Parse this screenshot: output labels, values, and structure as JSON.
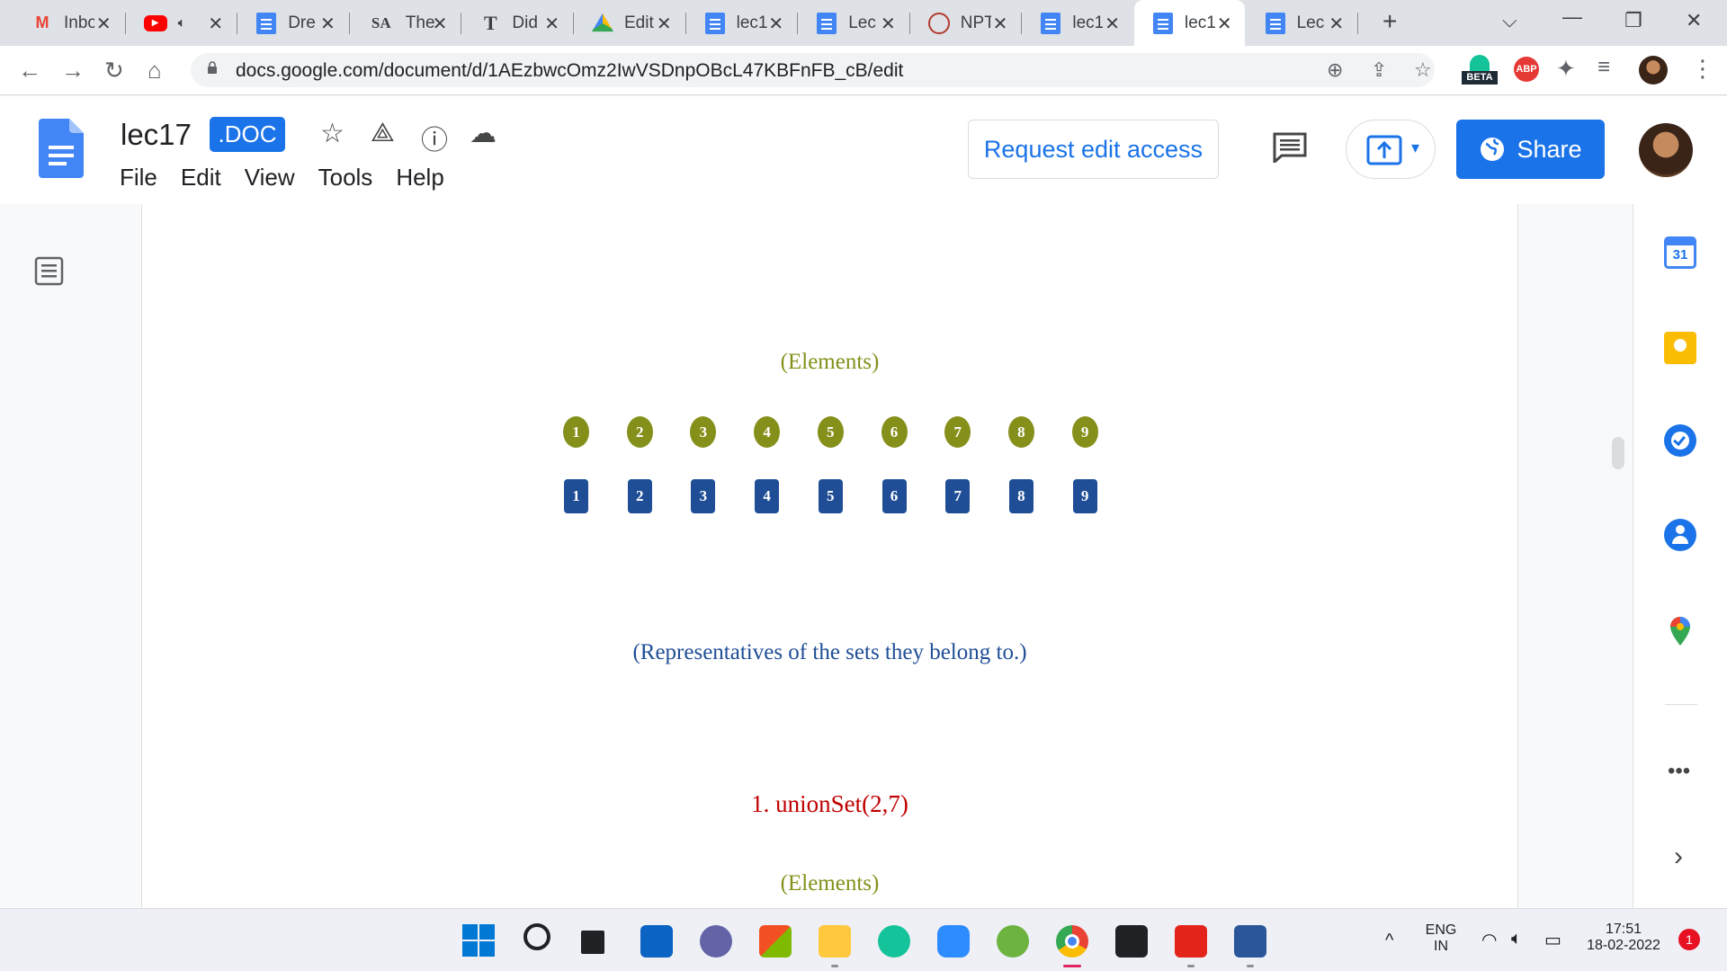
{
  "tabs": [
    {
      "title": "Inbox",
      "icon": "gmail-icon",
      "color": "#ea4335"
    },
    {
      "title": "",
      "icon": "youtube-icon",
      "color": "#ff0000",
      "muted": true
    },
    {
      "title": "Dre",
      "icon": "docs-icon",
      "color": "#4285f4"
    },
    {
      "title": "The",
      "icon": "sa-icon",
      "color": "#000000"
    },
    {
      "title": "Did",
      "icon": "nyt-icon",
      "color": "#000000"
    },
    {
      "title": "Edit",
      "icon": "drive-icon",
      "color": "#34a853"
    },
    {
      "title": "lec1",
      "icon": "docs-icon",
      "color": "#4285f4"
    },
    {
      "title": "Lec",
      "icon": "docs-icon",
      "color": "#4285f4"
    },
    {
      "title": "NPT",
      "icon": "nptel-icon",
      "color": "#b23b2c"
    },
    {
      "title": "lec1",
      "icon": "docs-icon",
      "color": "#4285f4"
    },
    {
      "title": "lec1",
      "icon": "docs-icon",
      "color": "#4285f4",
      "active": true
    },
    {
      "title": "Lec",
      "icon": "docs-icon",
      "color": "#4285f4"
    }
  ],
  "browser": {
    "url": "docs.google.com/document/d/1AEzbwcOmz2IwVSDnpOBcL47KBFnFB_cB/edit",
    "beta_label": "BETA",
    "abp_label": "ABP"
  },
  "doc": {
    "title": "lec17",
    "badge": ".DOC",
    "menu": [
      "File",
      "Edit",
      "View",
      "Tools",
      "Help"
    ],
    "request_edit": "Request edit access",
    "share": "Share"
  },
  "content": {
    "elements_caption": "(Elements)",
    "circles": [
      "1",
      "2",
      "3",
      "4",
      "5",
      "6",
      "7",
      "8",
      "9"
    ],
    "squares": [
      "1",
      "2",
      "3",
      "4",
      "5",
      "6",
      "7",
      "8",
      "9"
    ],
    "representatives_caption": "(Representatives of the sets they belong to.)",
    "step_heading": "1. unionSet(2,7)",
    "elements_caption_2": "(Elements)",
    "colors": {
      "olive": "#85901a",
      "navy": "#1f4e96",
      "red": "#c00000"
    }
  },
  "sidepanel": {
    "calendar_day": "31"
  },
  "system": {
    "lang_top": "ENG",
    "lang_bottom": "IN",
    "time": "17:51",
    "date": "18-02-2022",
    "notifications": "1"
  }
}
